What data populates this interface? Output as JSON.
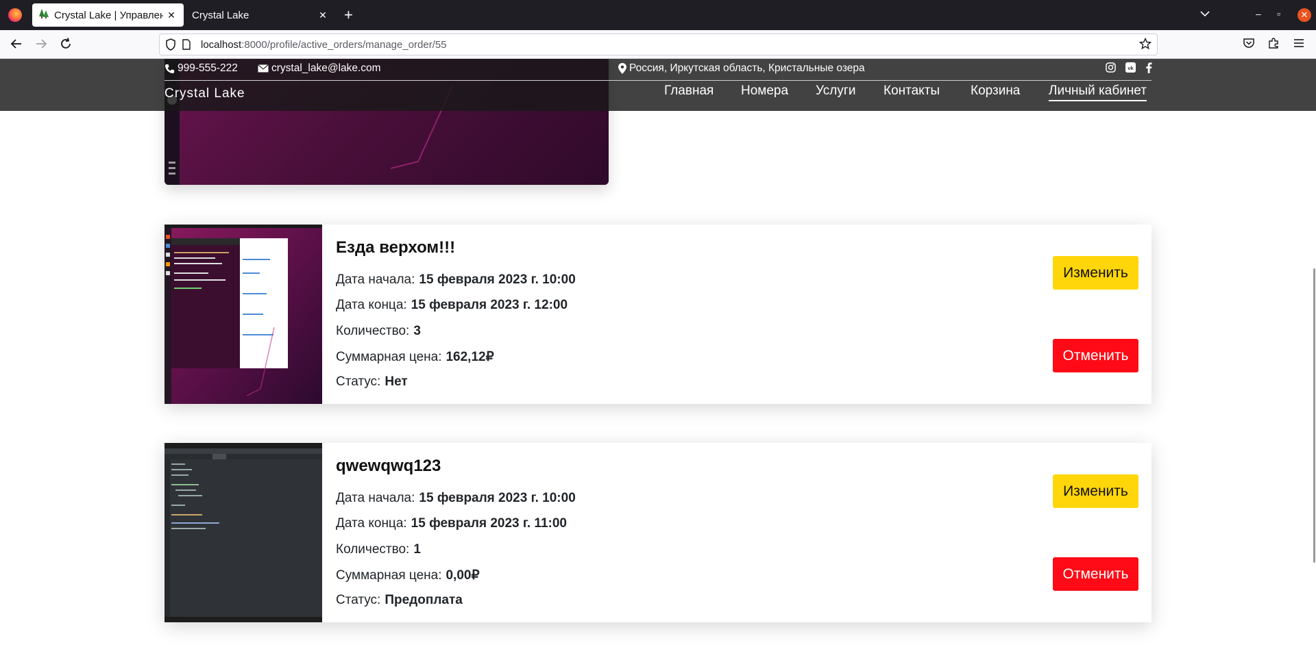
{
  "browser": {
    "tabs": [
      {
        "title": "Crystal Lake | Управлени",
        "active": true
      },
      {
        "title": "Crystal Lake",
        "active": false
      }
    ],
    "url_host": "localhost",
    "url_rest": ":8000/profile/active_orders/manage_order/55"
  },
  "site": {
    "phone": "999-555-222",
    "email": "crystal_lake@lake.com",
    "address": "Россия, Иркутская область, Кристальные озера",
    "brand": "Crystal Lake",
    "nav": [
      "Главная",
      "Номера",
      "Услуги",
      "Контакты",
      "Корзина",
      "Личный кабинет"
    ],
    "active_nav": "Личный кабинет"
  },
  "labels": {
    "start": "Дата начала:",
    "end": "Дата конца:",
    "qty": "Количество:",
    "total": "Суммарная цена:",
    "status": "Статус:",
    "edit": "Изменить",
    "cancel": "Отменить"
  },
  "orders": [
    {
      "title": "Езда верхом!!!",
      "start": "15 февраля 2023 г. 10:00",
      "end": "15 февраля 2023 г. 12:00",
      "qty": "3",
      "total": "162,12₽",
      "status": "Нет"
    },
    {
      "title": "qwewqwq123",
      "start": "15 февраля 2023 г. 10:00",
      "end": "15 февраля 2023 г. 11:00",
      "qty": "1",
      "total": "0,00₽",
      "status": "Предоплата"
    }
  ],
  "colors": {
    "edit_button": "#ffd60a",
    "cancel_button": "#ff0a16",
    "header_overlay": "#181818"
  }
}
